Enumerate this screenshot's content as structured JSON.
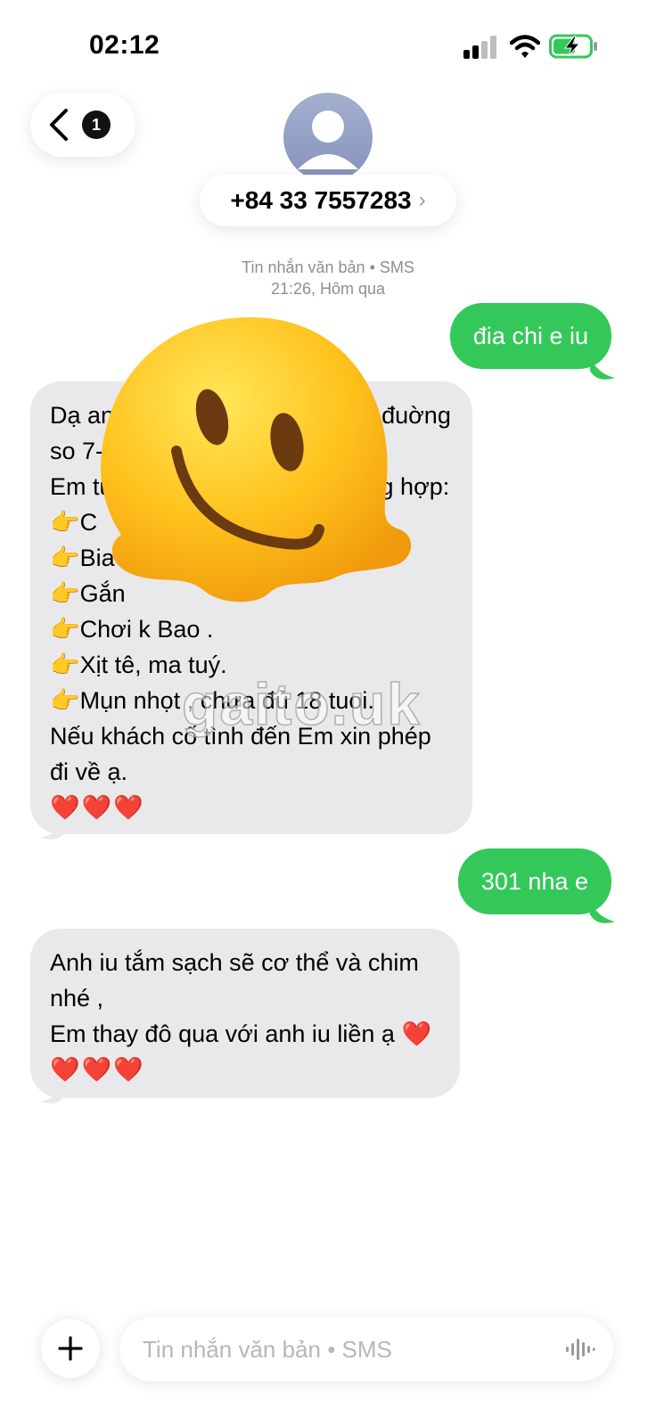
{
  "status_bar": {
    "time": "02:12"
  },
  "header": {
    "unread_count": "1",
    "contact_name": "+84 33 7557283",
    "contact_chevron": "›"
  },
  "thread_meta": {
    "channel": "Tin nhắn văn bản • SMS",
    "timestamp": "21:26, Hôm qua"
  },
  "messages": [
    {
      "direction": "outgoing",
      "text": "đia chi e iu"
    },
    {
      "direction": "incoming",
      "lines": [
        "Dạ an",
        "đuờng",
        "so 7-",
        "Em tu",
        "g hợp:",
        "👉C",
        "👉Bia ru",
        "👉Gắn",
        "👉Chơi k Bao .",
        "👉Xịt tê, ma tuý.",
        "👉Mụn nhọt , chưa đủ 18 tuoi.",
        "Nếu khách cố tình đến Em xin phép",
        "đi về ạ."
      ],
      "hearts": "❤️❤️❤️"
    },
    {
      "direction": "outgoing",
      "text": "301 nha e"
    },
    {
      "direction": "incoming",
      "lines": [
        "Anh iu  tắm sạch sẽ cơ thể và chim",
        "nhé ,",
        "Em thay đô qua với anh iu liền ạ ❤️"
      ],
      "hearts": "❤️❤️❤️"
    }
  ],
  "overlay": {
    "emoji": "melting-face-icon",
    "watermark": "gaito.uk"
  },
  "composer": {
    "placeholder": "Tin nhắn văn bản • SMS",
    "value": ""
  },
  "colors": {
    "outgoing_bubble": "#34c85a",
    "incoming_bubble": "#e9e9eb",
    "meta_text": "#8e8e93",
    "heart": "#e01b24"
  }
}
